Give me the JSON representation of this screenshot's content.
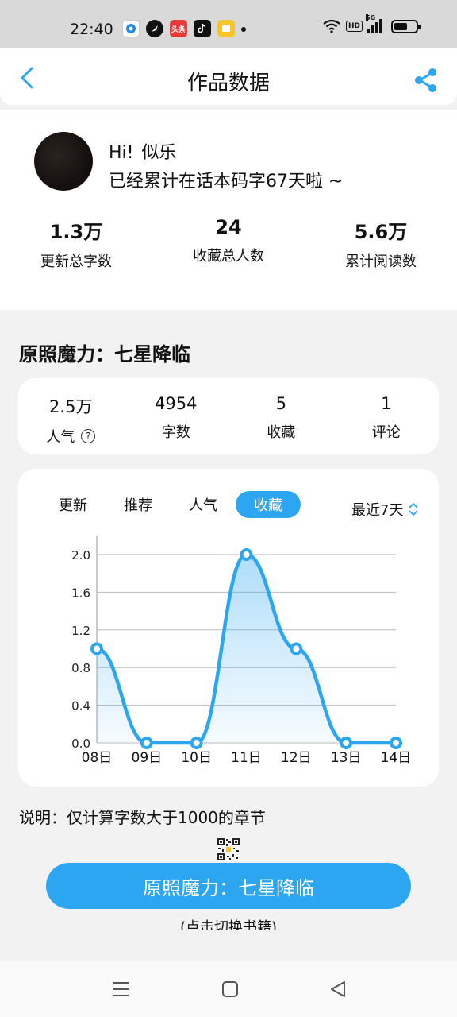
{
  "status_bar": {
    "time": "22:40",
    "app_icons": [
      "browser-icon",
      "feather-icon",
      "toutiao-icon",
      "tiktok-icon",
      "reader-icon"
    ],
    "toutiao_label": "头条",
    "network_label": "5G",
    "hd_label": "HD",
    "battery_level": 0.6
  },
  "header": {
    "title": "作品数据",
    "accent": "#2ca6f0"
  },
  "profile": {
    "greeting": "Hi!",
    "name": "似乐",
    "tagline": "已经累计在话本码字67天啦 ~",
    "stats": [
      {
        "value": "1.3万",
        "label": "更新总字数"
      },
      {
        "value": "24",
        "label": "收藏总人数"
      },
      {
        "value": "5.6万",
        "label": "累计阅读数"
      }
    ]
  },
  "work": {
    "title": "原照魔力：七星降临",
    "stats": [
      {
        "value": "2.5万",
        "label": "人气",
        "help": "?"
      },
      {
        "value": "4954",
        "label": "字数"
      },
      {
        "value": "5",
        "label": "收藏"
      },
      {
        "value": "1",
        "label": "评论"
      }
    ]
  },
  "chart_tabs": [
    {
      "label": "更新",
      "active": false
    },
    {
      "label": "推荐",
      "active": false
    },
    {
      "label": "人气",
      "active": false
    },
    {
      "label": "收藏",
      "active": true
    }
  ],
  "range_label": "最近7天",
  "chart_data": {
    "type": "area",
    "categories": [
      "08日",
      "09日",
      "10日",
      "11日",
      "12日",
      "13日",
      "14日"
    ],
    "values": [
      1,
      0,
      0,
      2,
      1,
      0,
      0
    ],
    "ylim": [
      0,
      2.0
    ],
    "yticks": [
      "0.0",
      "0.4",
      "0.8",
      "1.2",
      "1.6",
      "2.0"
    ],
    "grid": true,
    "color": "#2ca6f0"
  },
  "note": "说明：仅计算字数大于1000的章节",
  "main_button": "原照魔力：七星降临",
  "sub_hint": "(点击切换书籍)"
}
